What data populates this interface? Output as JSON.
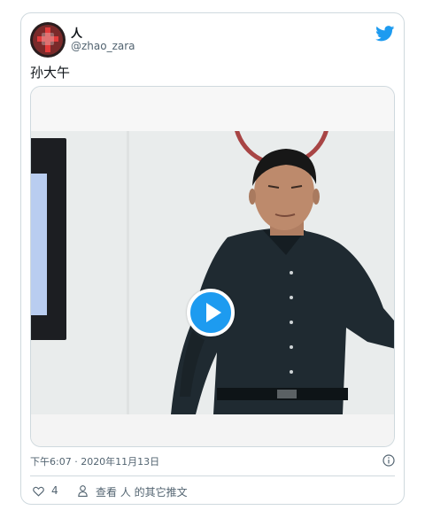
{
  "tweet": {
    "display_name": "人",
    "handle": "@zhao_zara",
    "text": "孙大午",
    "timestamp": "下午6:07 · 2020年11月13日",
    "like_count": "4",
    "more_tweets_label": "查看 人 的其它推文"
  },
  "colors": {
    "brand": "#1d9bf0",
    "border": "#cfd9de",
    "secondary_text": "#536471"
  },
  "icons": {
    "logo": "twitter-bird-icon",
    "play": "play-icon",
    "info": "info-icon",
    "like": "heart-icon",
    "profile": "person-icon"
  }
}
